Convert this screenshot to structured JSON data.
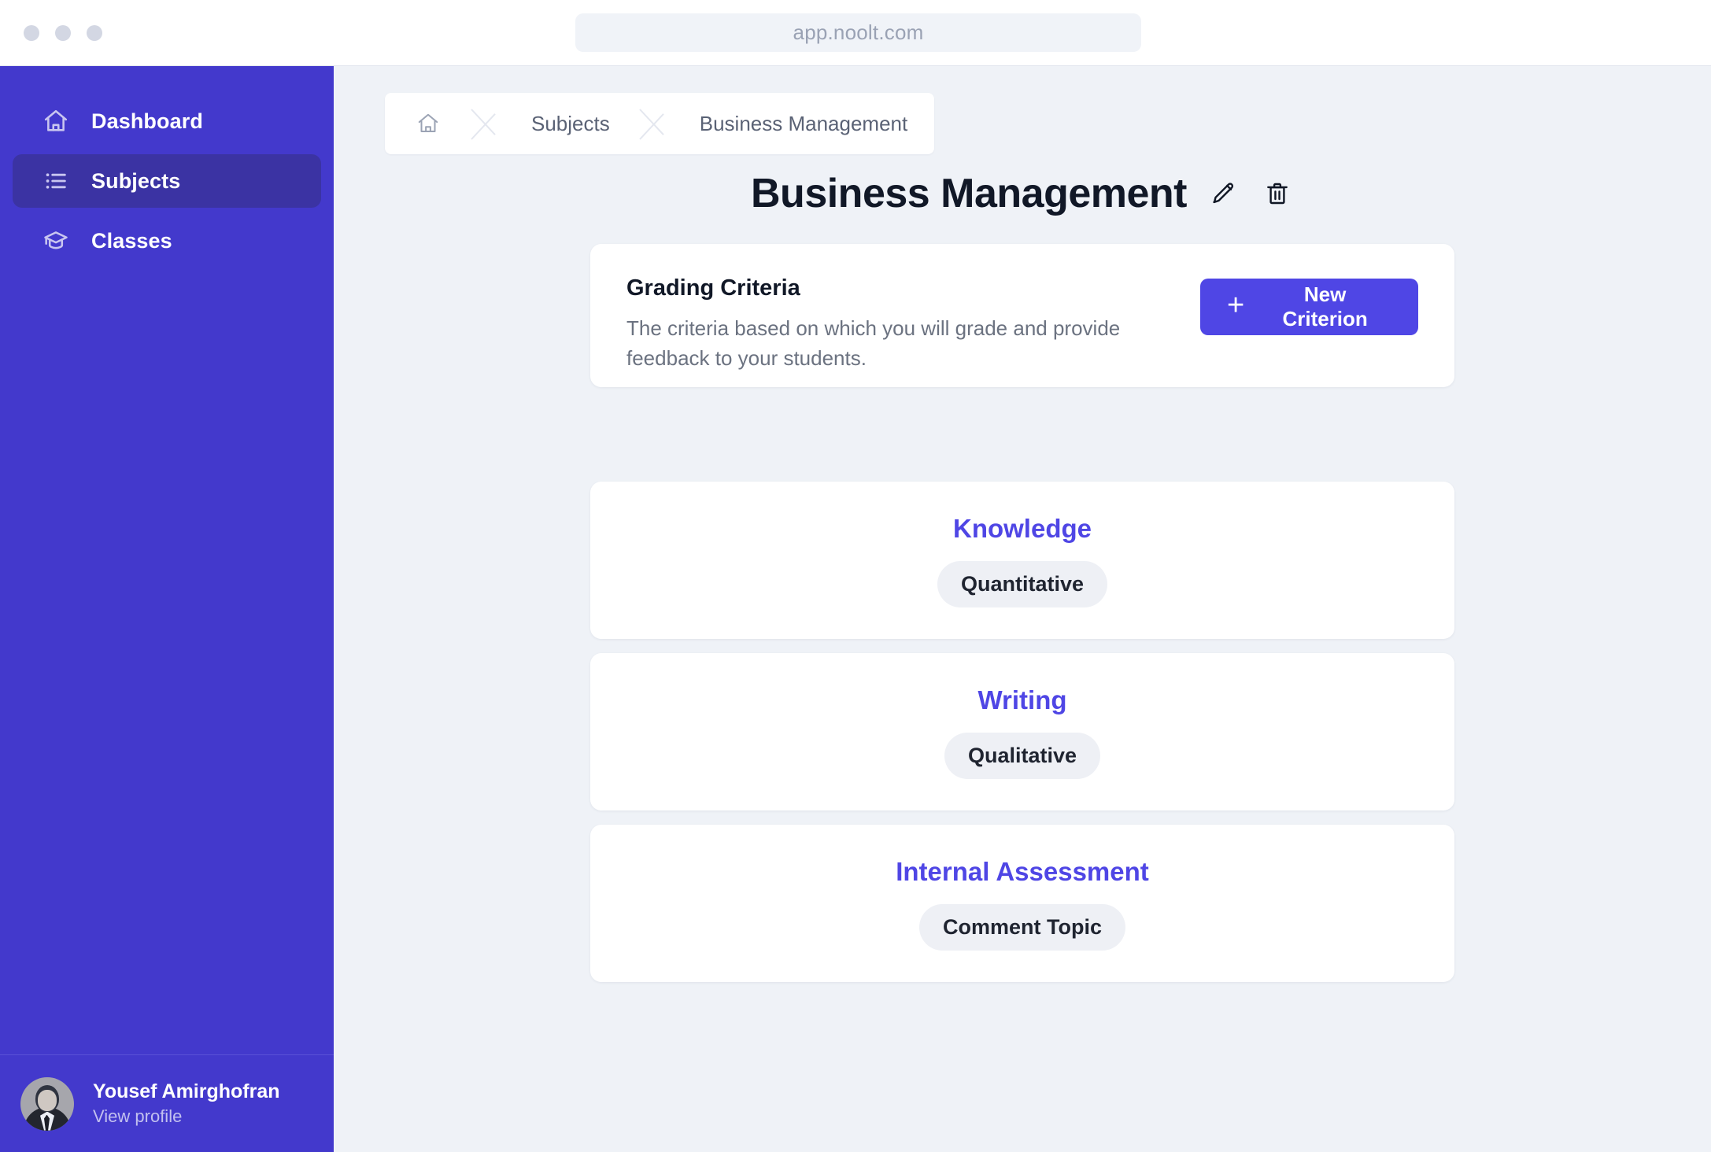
{
  "browser": {
    "url": "app.noolt.com",
    "traffic_lights": [
      "close",
      "minimize",
      "maximize"
    ]
  },
  "sidebar": {
    "items": [
      {
        "label": "Dashboard",
        "icon": "home-icon",
        "active": false
      },
      {
        "label": "Subjects",
        "icon": "list-icon",
        "active": true
      },
      {
        "label": "Classes",
        "icon": "graduation-cap-icon",
        "active": false
      }
    ],
    "profile": {
      "name": "Yousef Amirghofran",
      "action": "View profile"
    },
    "colors": {
      "background": "#4339cc",
      "active_item": "#3b33a3"
    }
  },
  "breadcrumb": {
    "home_icon": "home-icon",
    "items": [
      "Subjects",
      "Business Management"
    ]
  },
  "page": {
    "title": "Business Management",
    "edit_icon": "pencil-icon",
    "delete_icon": "trash-icon"
  },
  "grading_criteria": {
    "heading": "Grading Criteria",
    "description": "The criteria based on which you will grade and provide feedback to your students.",
    "new_button": "New Criterion",
    "new_button_icon": "plus-icon",
    "accent_color": "#4f46e5"
  },
  "criteria": [
    {
      "name": "Knowledge",
      "type": "Quantitative"
    },
    {
      "name": "Writing",
      "type": "Qualitative"
    },
    {
      "name": "Internal Assessment",
      "type": "Comment Topic"
    }
  ]
}
